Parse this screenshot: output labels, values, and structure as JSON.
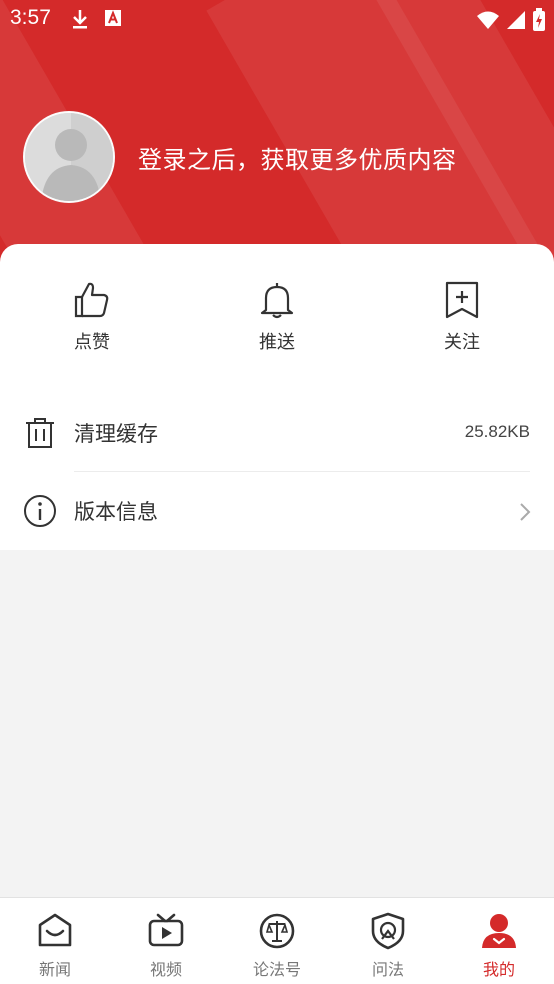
{
  "status_bar": {
    "time": "3:57",
    "left_icons": [
      "download-icon",
      "a-badge-icon"
    ],
    "right_icons": [
      "wifi-icon",
      "signal-icon",
      "battery-charging-icon"
    ]
  },
  "profile": {
    "avatar": "default-avatar",
    "login_prompt": "登录之后，获取更多优质内容"
  },
  "quick_actions": [
    {
      "label": "点赞",
      "icon": "thumbs-up-icon"
    },
    {
      "label": "推送",
      "icon": "bell-icon"
    },
    {
      "label": "关注",
      "icon": "bookmark-plus-icon"
    }
  ],
  "settings": [
    {
      "label": "清理缓存",
      "value": "25.82KB",
      "icon": "trash-icon"
    },
    {
      "label": "版本信息",
      "icon": "info-icon",
      "chevron": "chevron-right-icon"
    }
  ],
  "bottom_nav": [
    {
      "label": "新闻",
      "icon": "news-icon"
    },
    {
      "label": "视频",
      "icon": "tv-icon"
    },
    {
      "label": "论法号",
      "icon": "scale-icon"
    },
    {
      "label": "问法",
      "icon": "shield-icon"
    },
    {
      "label": "我的",
      "icon": "user-icon",
      "active": true
    }
  ],
  "colors": {
    "brand": "#d42a2a",
    "background": "#f3f3f3",
    "text": "#333333",
    "muted": "#777777"
  }
}
